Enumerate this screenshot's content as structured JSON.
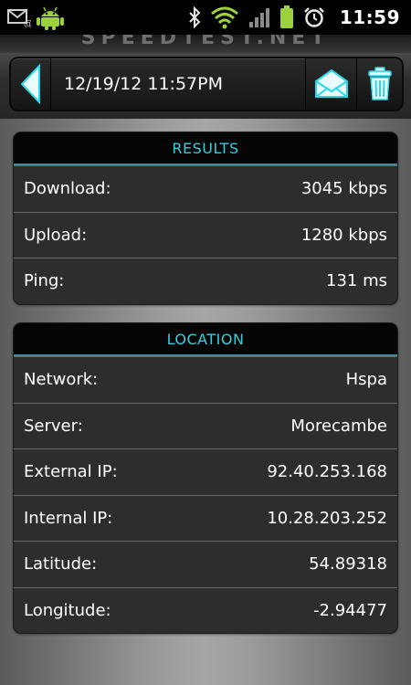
{
  "status_bar": {
    "time": "11:59",
    "icons": [
      "email-notification-icon",
      "android-icon",
      "bluetooth-icon",
      "wifi-icon",
      "signal-icon",
      "battery-icon",
      "alarm-icon"
    ]
  },
  "header": {
    "logo_text": "SPEEDTEST.NET",
    "title": "12/19/12 11:57PM",
    "icons": [
      "back-arrow-icon",
      "email-share-icon",
      "trash-icon"
    ]
  },
  "results": {
    "heading": "RESULTS",
    "rows": [
      {
        "label": "Download:",
        "value": "3045 kbps"
      },
      {
        "label": "Upload:",
        "value": "1280 kbps"
      },
      {
        "label": "Ping:",
        "value": "131 ms"
      }
    ]
  },
  "location": {
    "heading": "LOCATION",
    "rows": [
      {
        "label": "Network:",
        "value": "Hspa"
      },
      {
        "label": "Server:",
        "value": "Morecambe"
      },
      {
        "label": "External IP:",
        "value": "92.40.253.168"
      },
      {
        "label": "Internal IP:",
        "value": "10.28.203.252"
      },
      {
        "label": "Latitude:",
        "value": "54.89318"
      },
      {
        "label": "Longitude:",
        "value": "-2.94477"
      }
    ]
  },
  "colors": {
    "accent": "#2fd2e0",
    "icon_cyan": "#27d8e8",
    "android_green": "#9bd13a",
    "battery_green": "#9bd13a"
  }
}
